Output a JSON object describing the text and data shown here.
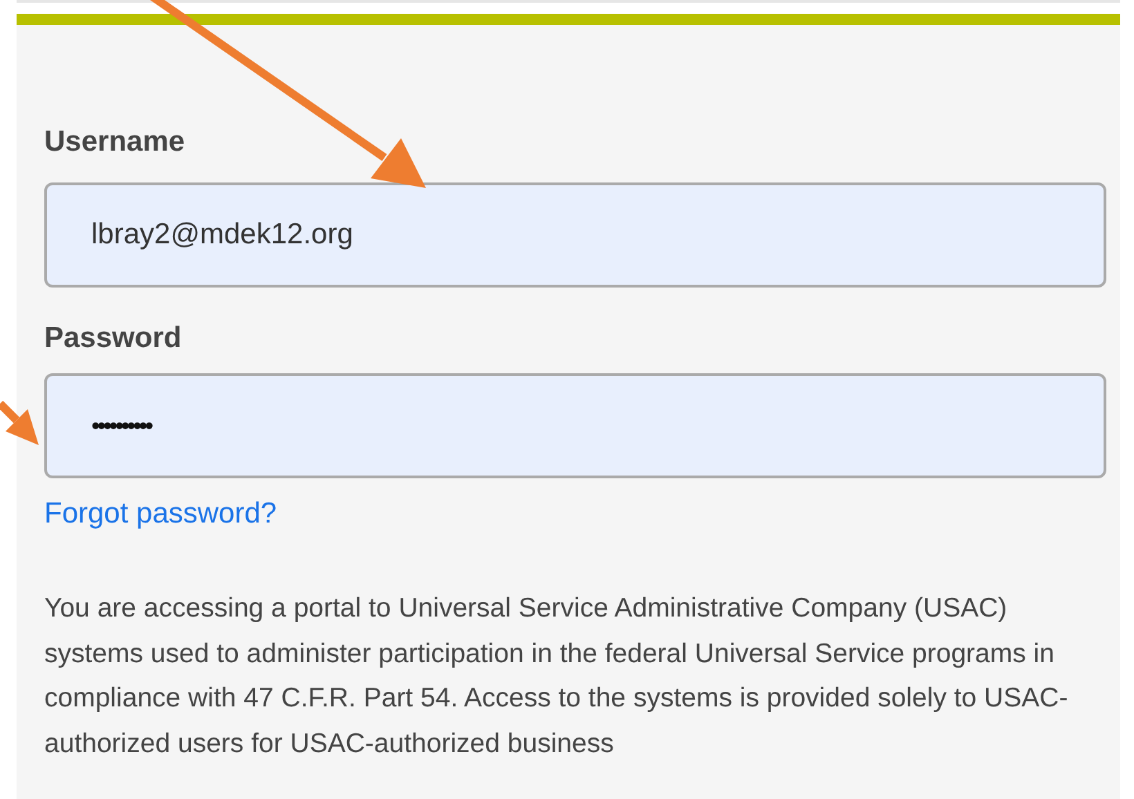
{
  "login_form": {
    "username": {
      "label": "Username",
      "value": "lbray2@mdek12.org"
    },
    "password": {
      "label": "Password",
      "value": "••••••••••"
    },
    "forgot_link": "Forgot password?",
    "notice": "You are accessing a portal to Universal Service Administrative Company (USAC) systems used to administer participation in the federal Universal Service programs in compliance with 47 C.F.R. Part 54. Access to the systems is provided solely to USAC-authorized users for USAC-authorized business"
  }
}
